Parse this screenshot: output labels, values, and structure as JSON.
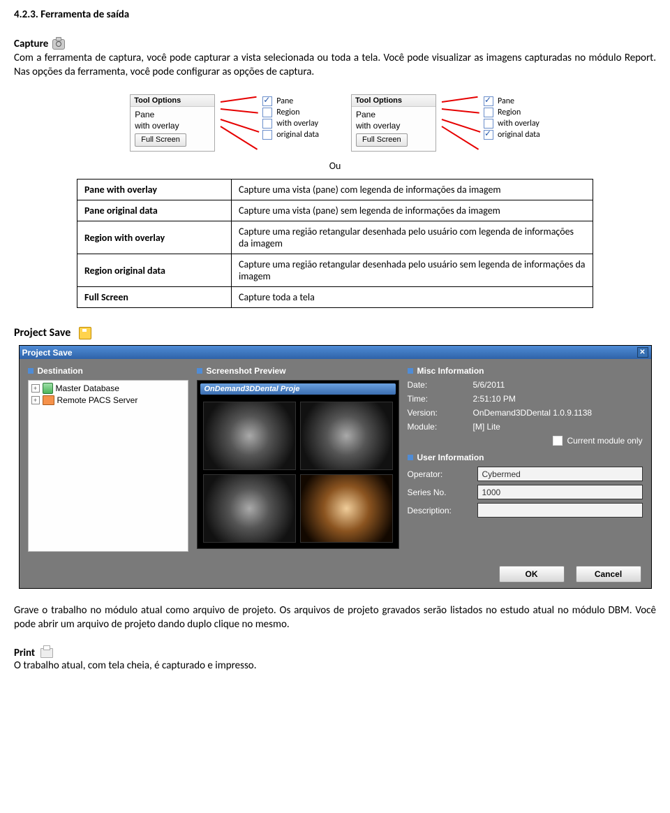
{
  "section_heading": "4.2.3.  Ferramenta de saída",
  "capture_label": "Capture",
  "capture_para": "Com a ferramenta de captura, você pode capturar a vista selecionada ou toda a tela. Você pode visualizar as imagens capturadas no módulo Report. Nas opções da ferramenta, você pode configurar as opções de captura.",
  "tool_options": {
    "title": "Tool Options",
    "line1": "Pane",
    "line2": "with overlay",
    "button": "Full Screen",
    "checks": [
      "Pane",
      "Region",
      "with overlay",
      "original data"
    ],
    "checked_left": [
      true,
      false,
      false,
      false
    ],
    "checked_right": [
      true,
      false,
      false,
      true
    ]
  },
  "ou": "Ou",
  "def_rows": [
    {
      "term": "Pane with overlay",
      "desc": "Capture uma vista (pane) com legenda de informações da imagem"
    },
    {
      "term": "Pane original data",
      "desc": "Capture uma vista (pane) sem legenda de informações da imagem"
    },
    {
      "term": "Region with overlay",
      "desc": "Capture uma região retangular desenhada pelo usuário com legenda de informações da imagem"
    },
    {
      "term": "Region original data",
      "desc": "Capture uma região retangular desenhada pelo usuário sem legenda de informações da imagem"
    },
    {
      "term": "Full Screen",
      "desc": "Capture toda a tela"
    }
  ],
  "project_save_label": "Project Save",
  "dialog": {
    "title": "Project Save",
    "destination_label": "Destination",
    "dest_items": [
      "Master Database",
      "Remote PACS Server"
    ],
    "preview_label": "Screenshot Preview",
    "preview_title": "OnDemand3DDental Proje",
    "misc_label": "Misc Information",
    "misc_rows": [
      {
        "k": "Date:",
        "v": "5/6/2011"
      },
      {
        "k": "Time:",
        "v": "2:51:10 PM"
      },
      {
        "k": "Version:",
        "v": "OnDemand3DDental 1.0.9.1138"
      },
      {
        "k": "Module:",
        "v": "[M] Lite"
      }
    ],
    "current_module_only": "Current module only",
    "user_label": "User Information",
    "user_rows": [
      {
        "k": "Operator:",
        "v": "Cybermed"
      },
      {
        "k": "Series No.",
        "v": "1000"
      },
      {
        "k": "Description:",
        "v": ""
      }
    ],
    "ok": "OK",
    "cancel": "Cancel"
  },
  "save_para": "Grave o trabalho no módulo atual como arquivo de projeto. Os arquivos de projeto gravados serão listados no estudo atual no módulo DBM. Você pode abrir um arquivo de projeto dando duplo clique no mesmo.",
  "print_label": "Print",
  "print_para": "O trabalho atual, com tela cheia, é capturado e impresso."
}
